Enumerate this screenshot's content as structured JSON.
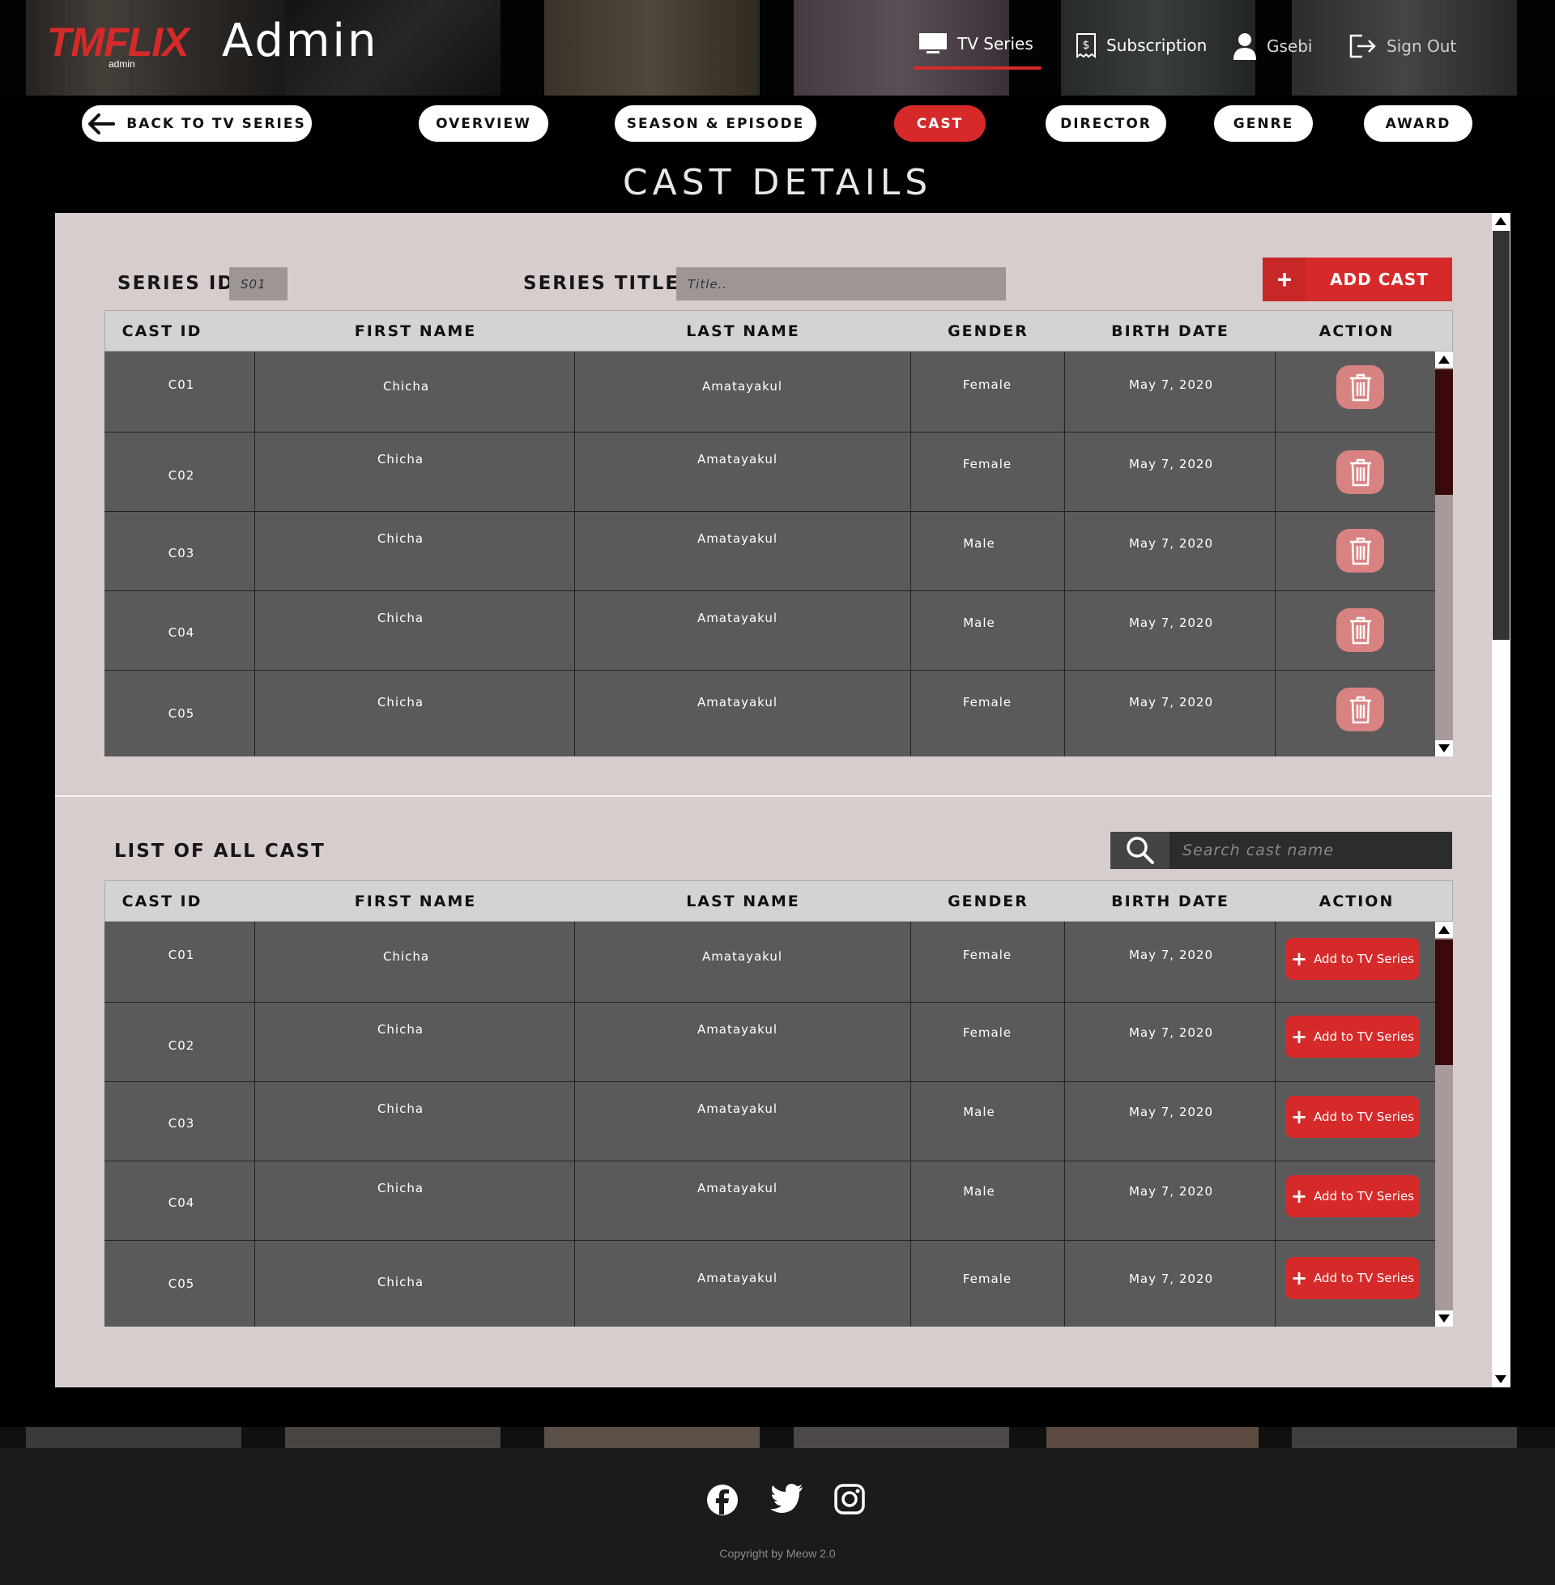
{
  "header": {
    "logo": "TMFLIX",
    "logo_sub": "admin",
    "title": "Admin",
    "nav": {
      "tv_series": "TV Series",
      "subscription": "Subscription",
      "user": "Gsebi",
      "sign_out": "Sign Out"
    }
  },
  "tabs": {
    "back": "BACK TO TV SERIES",
    "overview": "OVERVIEW",
    "season": "SEASON & EPISODE",
    "cast": "CAST",
    "director": "DIRECTOR",
    "genre": "GENRE",
    "award": "AWARD",
    "active": "CAST"
  },
  "page_title": "CAST DETAILS",
  "series_form": {
    "series_id_label": "SERIES ID:",
    "series_id_value": "S01",
    "series_title_label": "SERIES TITLE:",
    "series_title_placeholder": "Title..",
    "add_cast_button": "ADD CAST"
  },
  "columns": [
    "CAST ID",
    "FIRST NAME",
    "LAST NAME",
    "GENDER",
    "BIRTH DATE",
    "ACTION"
  ],
  "series_cast": [
    {
      "id": "C01",
      "first": "Chicha",
      "last": "Amatayakul",
      "gender": "Female",
      "birth": "May 7, 2020"
    },
    {
      "id": "C02",
      "first": "Chicha",
      "last": "Amatayakul",
      "gender": "Female",
      "birth": "May 7, 2020"
    },
    {
      "id": "C03",
      "first": "Chicha",
      "last": "Amatayakul",
      "gender": "Male",
      "birth": "May 7, 2020"
    },
    {
      "id": "C04",
      "first": "Chicha",
      "last": "Amatayakul",
      "gender": "Male",
      "birth": "May 7, 2020"
    },
    {
      "id": "C05",
      "first": "Chicha",
      "last": "Amatayakul",
      "gender": "Female",
      "birth": "May 7, 2020"
    }
  ],
  "all_cast_section": {
    "title": "LIST OF ALL CAST",
    "search_placeholder": "Search cast name",
    "add_button_label": "Add to TV Series"
  },
  "all_cast": [
    {
      "id": "C01",
      "first": "Chicha",
      "last": "Amatayakul",
      "gender": "Female",
      "birth": "May 7, 2020"
    },
    {
      "id": "C02",
      "first": "Chicha",
      "last": "Amatayakul",
      "gender": "Female",
      "birth": "May 7, 2020"
    },
    {
      "id": "C03",
      "first": "Chicha",
      "last": "Amatayakul",
      "gender": "Male",
      "birth": "May 7, 2020"
    },
    {
      "id": "C04",
      "first": "Chicha",
      "last": "Amatayakul",
      "gender": "Male",
      "birth": "May 7, 2020"
    },
    {
      "id": "C05",
      "first": "Chicha",
      "last": "Amatayakul",
      "gender": "Female",
      "birth": "May 7, 2020"
    }
  ],
  "footer": {
    "social_icons": [
      "facebook-icon",
      "twitter-icon",
      "instagram-icon"
    ],
    "copyright": "Copyright by Meow 2.0"
  },
  "colors": {
    "accent": "#d62a2a",
    "panel": "#d8cdcd",
    "table_body": "#5b5a5b",
    "trash_button": "#d98282"
  }
}
